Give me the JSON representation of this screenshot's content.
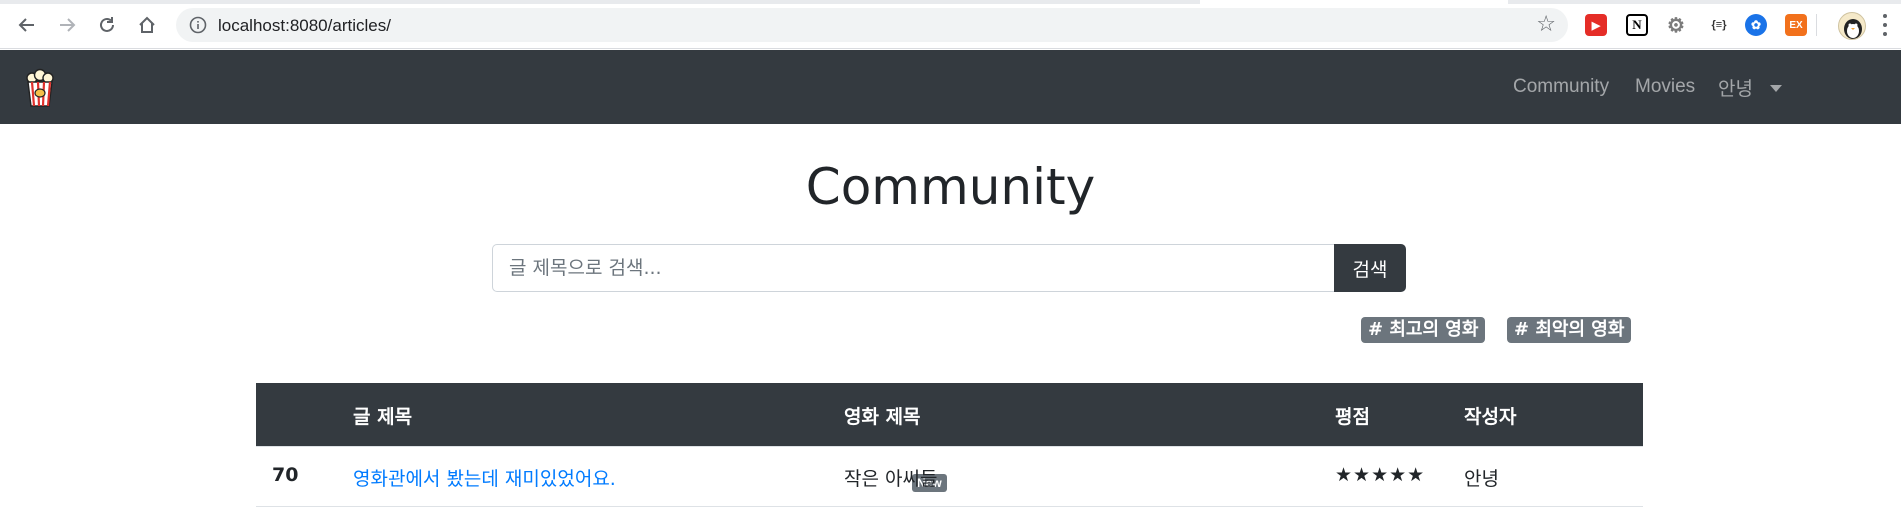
{
  "browser": {
    "url": "localhost:8080/articles/",
    "extensions": [
      {
        "name": "youtube-ext-icon",
        "glyph": "▶",
        "color": "#e52d27"
      },
      {
        "name": "notion-icon",
        "glyph": "N",
        "color": "#000000"
      },
      {
        "name": "settings-ext-icon",
        "glyph": "⚙",
        "color": "#7c7c7c"
      },
      {
        "name": "json-ext-icon",
        "glyph": "{≡}",
        "color": "#555555"
      },
      {
        "name": "translate-ext-icon",
        "glyph": "✿",
        "color": "#1a73e8"
      },
      {
        "name": "ex-ext-icon",
        "glyph": "EX",
        "color": "#f2711c"
      }
    ]
  },
  "navbar": {
    "links": [
      "Community",
      "Movies"
    ],
    "user_menu": "안녕"
  },
  "main": {
    "title": "Community",
    "search": {
      "placeholder": "글 제목으로 검색...",
      "button_label": "검색"
    },
    "tags": [
      "# 최고의 영화",
      "# 최악의 영화"
    ]
  },
  "table": {
    "headers": [
      "",
      "글 제목",
      "영화 제목",
      "평점",
      "작성자"
    ],
    "rows": [
      {
        "id": "70",
        "title": "영화관에서 봤는데 재미있었어요.",
        "badge": "New",
        "movie": "작은 아씨들",
        "rating": "★★★★★",
        "author": "안녕"
      }
    ]
  },
  "colors": {
    "navbar_bg": "#343a40",
    "link": "#007bff",
    "tag_bg": "#6c757d"
  }
}
